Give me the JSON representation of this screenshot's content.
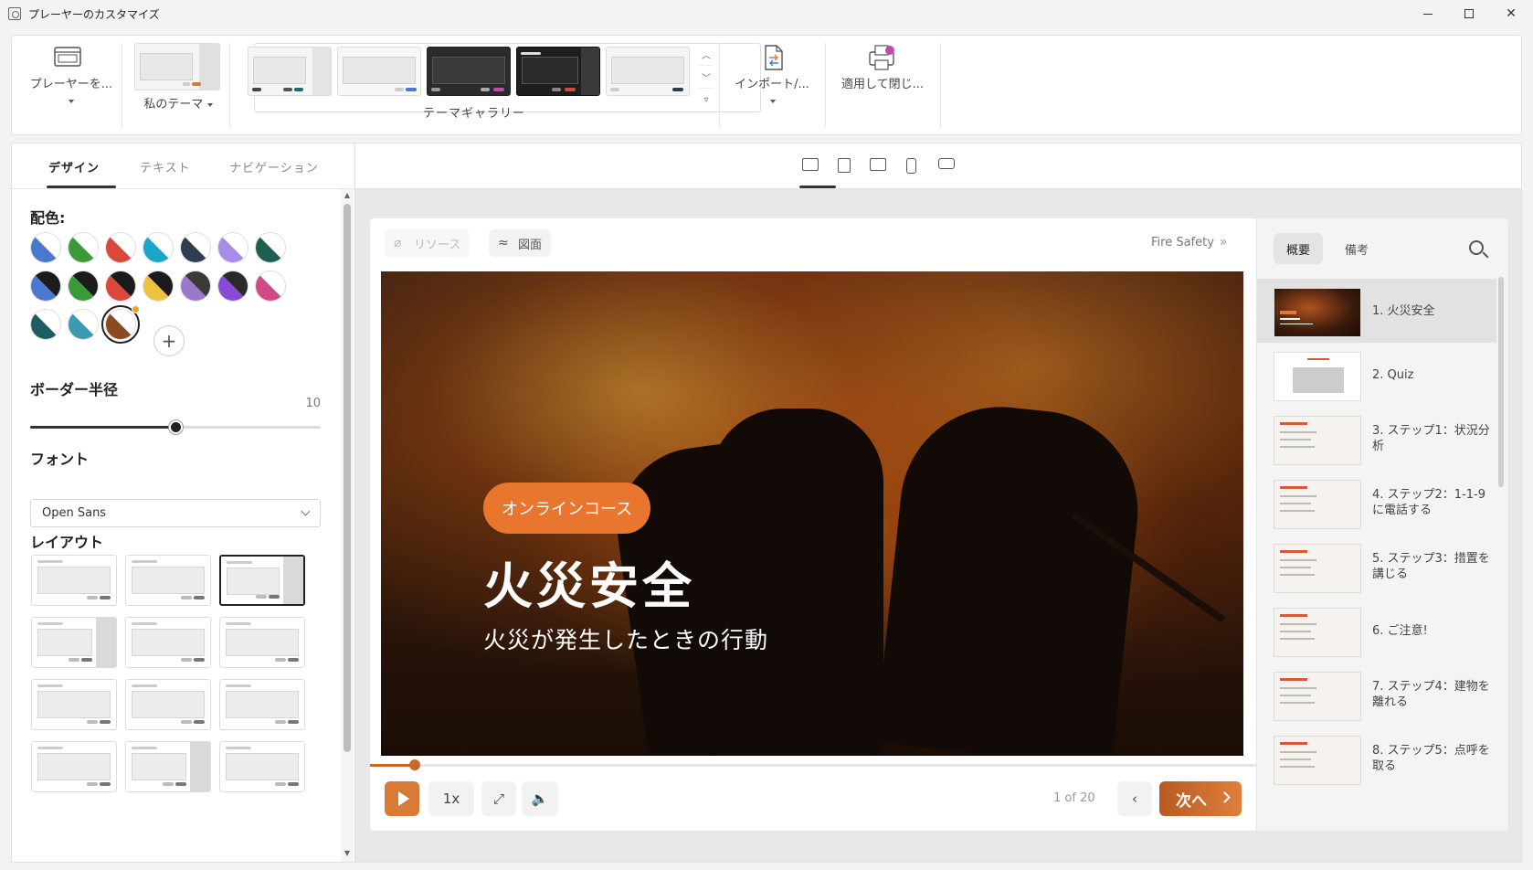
{
  "window": {
    "title": "プレーヤーのカスタマイズ"
  },
  "ribbon": {
    "player_label": "プレーヤーを...",
    "my_theme_label": "私のテーマ",
    "gallery_label": "テーマギャラリー",
    "import_label": "インポート/...",
    "apply_label": "適用して閉じ..."
  },
  "tabs": {
    "design": "デザイン",
    "text": "テキスト",
    "navigation": "ナビゲーション"
  },
  "design": {
    "color_title": "配色:",
    "border_radius_title": "ボーダー半径",
    "border_radius_value": "10",
    "border_radius_max": 20,
    "font_title": "フォント",
    "font_value": "Open Sans",
    "layout_title": "レイアウト",
    "swatches": [
      {
        "a": "#ffffff",
        "b": "#4a78d0"
      },
      {
        "a": "#ffffff",
        "b": "#3a9a3a"
      },
      {
        "a": "#ffffff",
        "b": "#d9483a"
      },
      {
        "a": "#ffffff",
        "b": "#1aa6c8"
      },
      {
        "a": "#ffffff",
        "b": "#2f3d4f"
      },
      {
        "a": "#ffffff",
        "b": "#a98be8"
      },
      {
        "a": "#ffffff",
        "b": "#1e5f52"
      },
      {
        "a": "#1b1b1b",
        "b": "#4a78d0"
      },
      {
        "a": "#1b1b1b",
        "b": "#3a9a3a"
      },
      {
        "a": "#1b1b1b",
        "b": "#d9483a"
      },
      {
        "a": "#1b1b1b",
        "b": "#f0c040"
      },
      {
        "a": "#3a3a3a",
        "b": "#9a7ac8"
      },
      {
        "a": "#2a2a2a",
        "b": "#8a4ad8"
      },
      {
        "a": "#ffffff",
        "b": "#d04a8a"
      },
      {
        "a": "#ffffff",
        "b": "#1d5c60"
      },
      {
        "a": "#ffffff",
        "b": "#3a9ab0"
      },
      {
        "a": "#ffffff",
        "b": "#8a4a20"
      }
    ]
  },
  "player": {
    "resources_label": "リソース",
    "diagram_label": "図面",
    "course_name": "Fire Safety",
    "slide_badge": "オンラインコース",
    "slide_title": "火災安全",
    "slide_subtitle": "火災が発生したときの行動",
    "speed_label": "1x",
    "page_count": "1 of 20",
    "next_label": "次へ",
    "progress": 0.05
  },
  "sidebar": {
    "tab_outline": "概要",
    "tab_notes": "備考",
    "items": [
      "1. 火災安全",
      "2. Quiz",
      "3. ステップ1：状況分析",
      "4. ステップ2：1-1-9に電話する",
      "5. ステップ3：措置を講じる",
      "6. ご注意!",
      "7. ステップ4：建物を離れる",
      "8. ステップ5：点呼を取る"
    ]
  },
  "colors": {
    "accent": "#d97b37",
    "badge": "#e9762f",
    "dark": "#222222"
  }
}
